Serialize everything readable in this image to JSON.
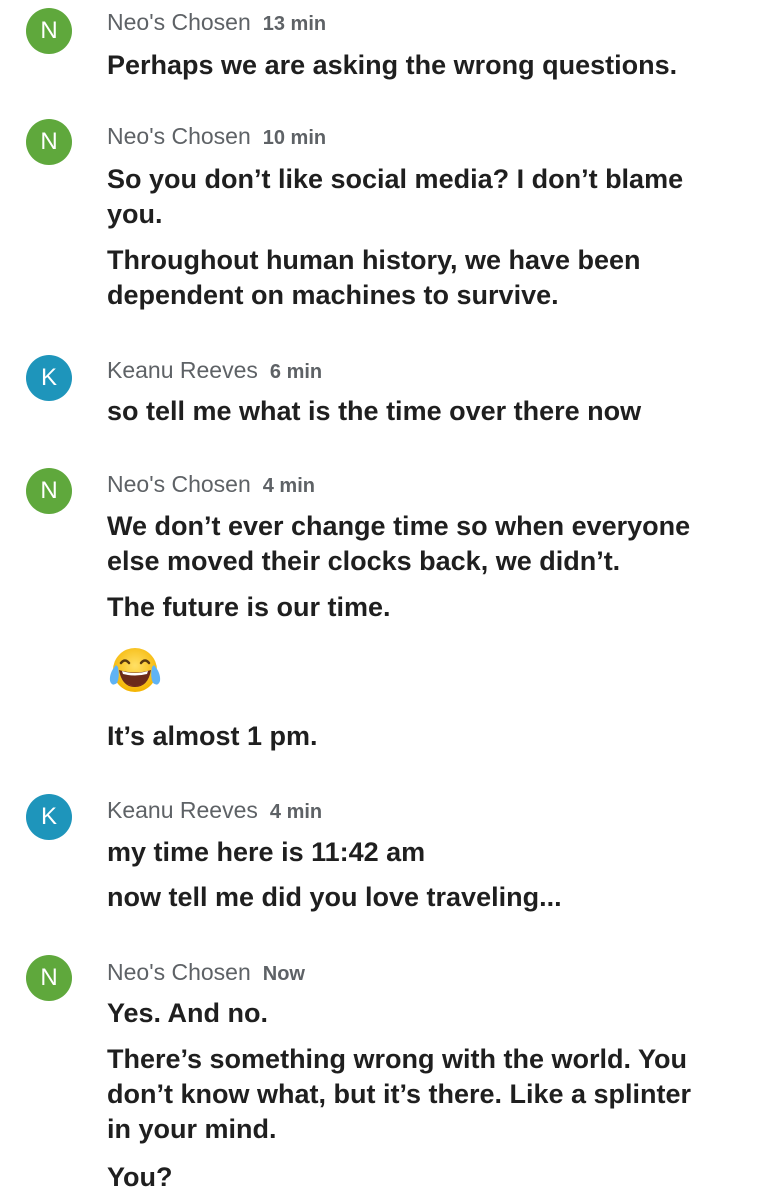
{
  "messages": [
    {
      "avatar": "N",
      "sender": "Neo's Chosen",
      "time": "13 min",
      "lines": [
        "Perhaps we are asking the wrong questions."
      ]
    },
    {
      "avatar": "N",
      "sender": "Neo's Chosen",
      "time": "10 min",
      "lines": [
        "So you don’t like social media? I don’t blame you.",
        "Throughout human history, we have been dependent on machines to survive."
      ]
    },
    {
      "avatar": "K",
      "sender": "Keanu Reeves",
      "time": "6 min",
      "lines": [
        "so tell me what is the time over there now"
      ]
    },
    {
      "avatar": "N",
      "sender": "Neo's Chosen",
      "time": "4 min",
      "lines": [
        "We don’t ever change time so when everyone else moved their clocks back, we didn’t.",
        "The future is our time.",
        "It’s almost 1 pm."
      ],
      "emoji": "face-with-tears-of-joy-emoji"
    },
    {
      "avatar": "K",
      "sender": "Keanu Reeves",
      "time": "4 min",
      "lines": [
        "my time here is 11:42 am",
        "now tell me did you love traveling..."
      ]
    },
    {
      "avatar": "N",
      "sender": "Neo's Chosen",
      "time": "Now",
      "lines": [
        "Yes. And no.",
        "There’s something wrong with the world. You don’t know what, but it’s there. Like a splinter in your mind.",
        "You?"
      ]
    }
  ],
  "colors": {
    "avatar_n": "#5fa83c",
    "avatar_k": "#1e95bb",
    "meta_text": "#5e6266",
    "body_text": "#1f1f1f"
  }
}
